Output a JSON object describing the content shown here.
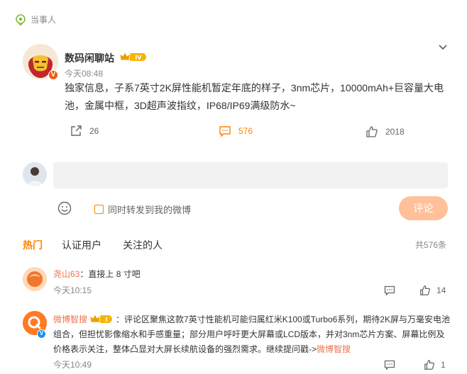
{
  "header": {
    "tag_label": "当事人"
  },
  "post": {
    "author": "数码闲聊站",
    "level_badge": "IV",
    "time": "今天08:48",
    "text": "独家信息，子系7英寸2K屏性能机暂定年底的样子，3nm芯片，10000mAh+巨容量大电池，金属中框，3D超声波指纹，IP68/IP69满级防水~",
    "verify_badge": "V",
    "actions": {
      "share_count": "26",
      "comment_count": "576",
      "like_count": "2018"
    }
  },
  "composer": {
    "input_value": "",
    "forward_label": "同时转发到我的微博",
    "submit_label": "评论"
  },
  "tabs": [
    {
      "label": "热门",
      "active": true
    },
    {
      "label": "认证用户",
      "active": false
    },
    {
      "label": "关注的人",
      "active": false
    }
  ],
  "total_label": "共576条",
  "comments": [
    {
      "author": "尧山63",
      "separator": "：",
      "text": "直接上 8 寸吧",
      "time": "今天10:15",
      "like_count": "14"
    },
    {
      "author": "微博智搜",
      "level_badge": "I",
      "verify_badge": "V",
      "separator": "：",
      "text": "评论区聚焦这款7英寸性能机可能归属红米K100或Turbo6系列，期待2K屏与万毫安电池组合，但担忧影像缩水和手感重量；部分用户呼吁更大屏幕或LCD版本，并对3nm芯片方案、屏幕比例及价格表示关注，整体凸显对大屏长续航设备的强烈需求。继续提问戳->",
      "link_text": "微博智搜",
      "time": "今天10:49",
      "like_count": "1"
    }
  ],
  "colors": {
    "accent": "#ff8200",
    "username": "#eb7350",
    "submit_disabled": "#ffc09a",
    "input_bg": "#f2f2f2"
  },
  "icons": [
    "location-pin-icon",
    "crown-badge-icon",
    "chevron-down-icon",
    "share-icon",
    "comment-icon",
    "like-icon",
    "emoji-icon",
    "reply-icon"
  ]
}
